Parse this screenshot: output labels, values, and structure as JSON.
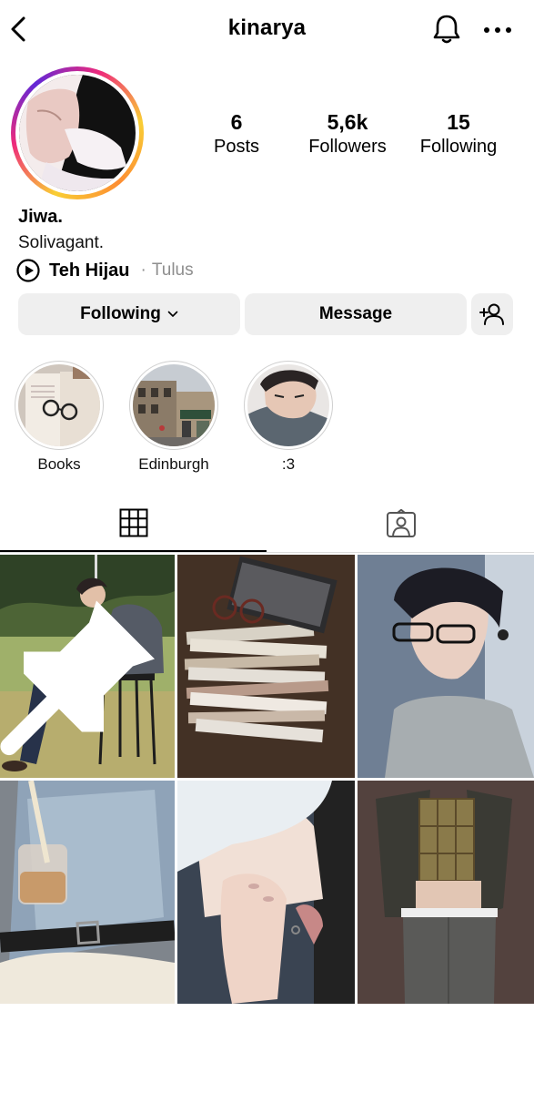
{
  "header": {
    "username": "kinarya",
    "icons": [
      "back-icon",
      "bell-icon",
      "more-icon"
    ]
  },
  "stats": {
    "posts_count": "6",
    "posts_label": "Posts",
    "followers_count": "5,6k",
    "followers_label": "Followers",
    "following_count": "15",
    "following_label": "Following"
  },
  "bio": {
    "name": "Jiwa.",
    "text": "Solivagant.",
    "song": "Teh Hijau",
    "separator": "·",
    "artist": "Tulus"
  },
  "actions": {
    "following_label": "Following",
    "message_label": "Message"
  },
  "highlights": [
    {
      "label": "Books"
    },
    {
      "label": "Edinburgh"
    },
    {
      "label": ":3"
    }
  ],
  "tabs": {
    "active": "grid",
    "icons": [
      "grid-icon",
      "tagged-icon"
    ]
  },
  "posts": [
    {
      "pinned": true
    },
    {
      "pinned": false
    },
    {
      "pinned": false
    },
    {
      "pinned": false
    },
    {
      "pinned": false
    },
    {
      "pinned": false
    }
  ],
  "colors": {
    "button_bg": "#efefef",
    "muted_text": "#8e8e8e",
    "divider": "#dbdbdb",
    "story_ring": [
      "#f9ce34",
      "#ee2a7b",
      "#6228d7"
    ]
  }
}
